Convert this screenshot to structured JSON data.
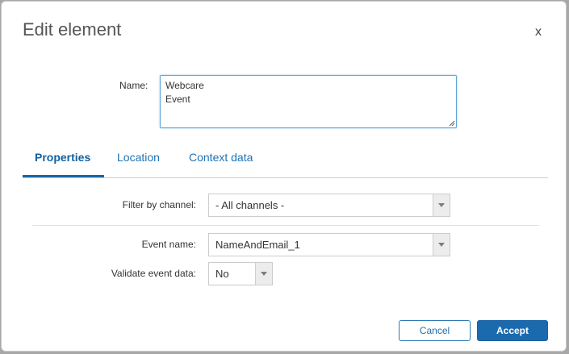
{
  "dialog": {
    "title": "Edit element",
    "close_label": "x"
  },
  "name_field": {
    "label": "Name:",
    "lines": [
      "Webcare",
      "Event"
    ]
  },
  "tabs": [
    {
      "label": "Properties",
      "active": true
    },
    {
      "label": "Location",
      "active": false
    },
    {
      "label": "Context data",
      "active": false
    }
  ],
  "properties": {
    "filter_by_channel": {
      "label": "Filter by channel:",
      "value": "- All channels -"
    },
    "event_name": {
      "label": "Event name:",
      "value": "NameAndEmail_1"
    },
    "validate_event_data": {
      "label": "Validate event data:",
      "value": "No"
    }
  },
  "footer": {
    "cancel_label": "Cancel",
    "accept_label": "Accept"
  },
  "colors": {
    "accent": "#1c6aae",
    "tab_active": "#1060a0",
    "focus_border": "#5ea7dc"
  }
}
